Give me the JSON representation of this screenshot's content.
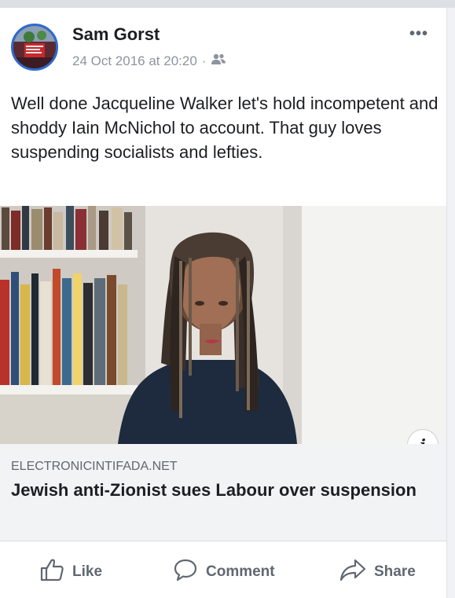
{
  "post": {
    "author": "Sam Gorst",
    "timestamp": "24 Oct 2016 at 20:20",
    "separator": "·",
    "audience_icon": "friends-icon",
    "more_label": "•••",
    "text": "Well done Jacqueline Walker let's hold incompetent and shoddy Iain McNichol to account. That guy loves suspending socialists and lefties."
  },
  "link": {
    "domain": "ELECTRONICINTIFADA.NET",
    "headline": "Jewish anti-Zionist sues Labour over suspension",
    "info_label": "i"
  },
  "actions": {
    "like": "Like",
    "comment": "Comment",
    "share": "Share"
  },
  "colors": {
    "text": "#1c1e21",
    "secondary": "#606770",
    "avatar_ring": "#2d6bd0",
    "link_bg": "#f2f3f5"
  }
}
